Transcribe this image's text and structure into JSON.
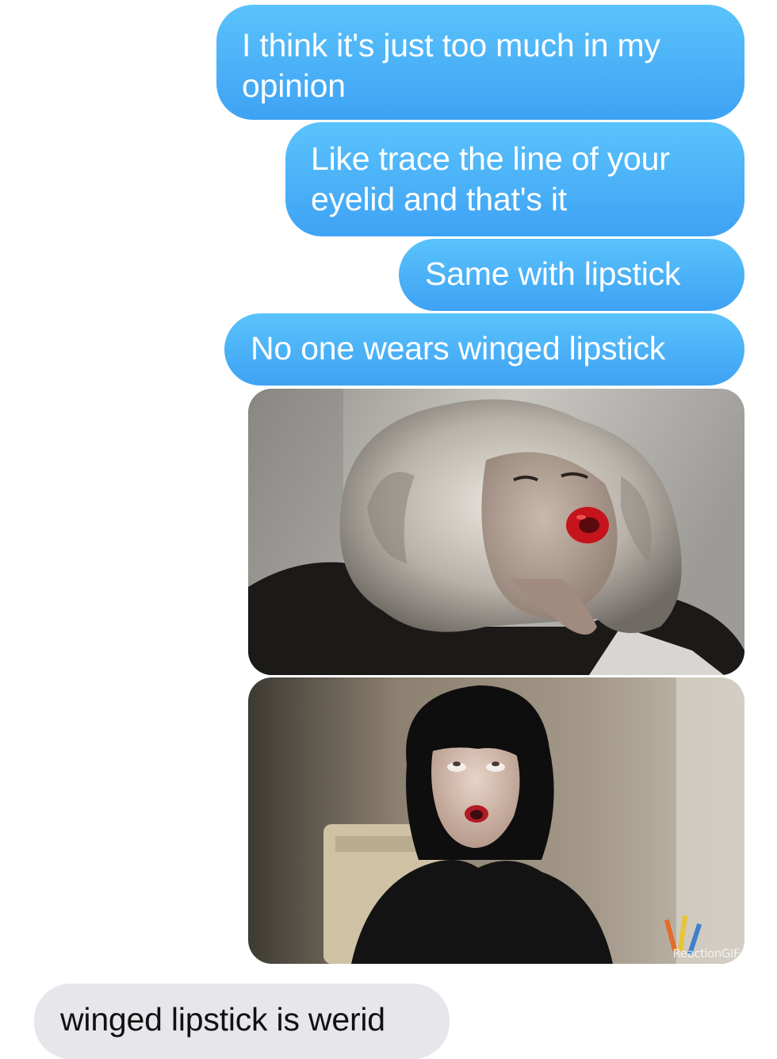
{
  "conversation": {
    "messages": [
      {
        "type": "text",
        "direction": "sent",
        "text": "I think it's just too much in my opinion"
      },
      {
        "type": "text",
        "direction": "sent",
        "text": "Like trace the line of your eyelid and that's it"
      },
      {
        "type": "text",
        "direction": "sent",
        "text": "Same with lipstick"
      },
      {
        "type": "text",
        "direction": "sent",
        "text": "No one wears winged lipstick"
      },
      {
        "type": "gif",
        "direction": "sent",
        "subject": "woman with curly blonde hair blowing a kiss with red lips"
      },
      {
        "type": "gif",
        "direction": "sent",
        "subject": "woman with black bangs rolling her eyes",
        "watermark": "ReactionGIF"
      },
      {
        "type": "text",
        "direction": "received",
        "text": "winged lipstick is werid"
      }
    ]
  },
  "colors": {
    "sent_bubble_top": "#5ac3fb",
    "sent_bubble_bottom": "#3ea2f4",
    "received_bubble": "#e6e6eb",
    "received_text": "#111111"
  }
}
